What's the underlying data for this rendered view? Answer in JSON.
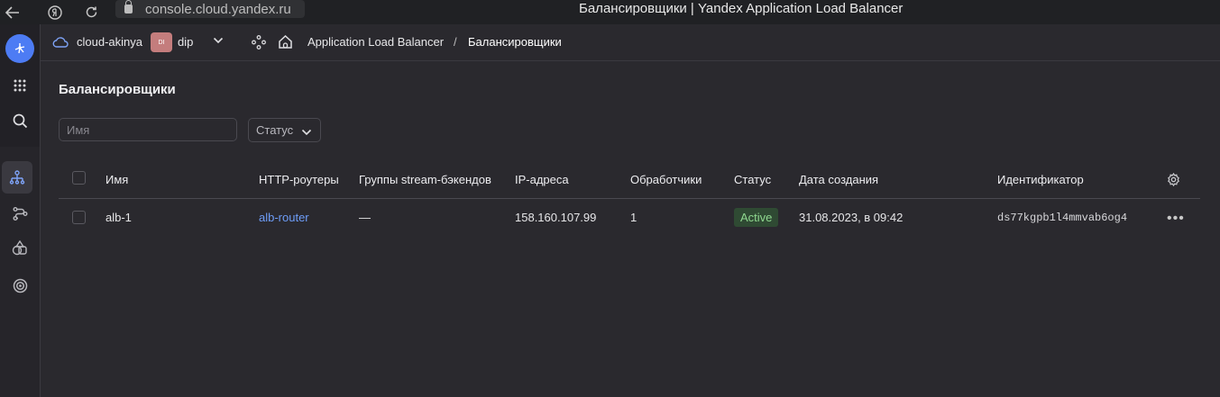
{
  "browser": {
    "url": "console.cloud.yandex.ru",
    "tab_title": "Балансировщики | Yandex Application Load Balancer"
  },
  "rail": {
    "items": [
      "app-logo-icon",
      "services-grid-icon",
      "search-icon",
      "balancer-icon",
      "routes-icon",
      "shapes-icon",
      "target-icon"
    ]
  },
  "header": {
    "cloud": "cloud-akinya",
    "folder_badge": "DI",
    "folder": "dip",
    "breadcrumb_service": "Application Load Balancer",
    "breadcrumb_sep": "/",
    "breadcrumb_current": "Балансировщики"
  },
  "page": {
    "title": "Балансировщики",
    "filter_name_placeholder": "Имя",
    "filter_status_label": "Статус"
  },
  "table": {
    "columns": [
      "Имя",
      "HTTP-роутеры",
      "Группы stream-бэкендов",
      "IP-адреса",
      "Обработчики",
      "Статус",
      "Дата создания",
      "Идентификатор"
    ],
    "rows": [
      {
        "name": "alb-1",
        "http_router": "alb-router",
        "stream_groups": "—",
        "ip": "158.160.107.99",
        "listeners": "1",
        "status": "Active",
        "created": "31.08.2023, в 09:42",
        "id": "ds77kgpb1l4mmvab6og4"
      }
    ]
  },
  "colors": {
    "accent": "#4d7cf4",
    "link": "#6d9cf7",
    "status_active_bg": "#2f4a33",
    "status_active_text": "#8fd88f"
  }
}
